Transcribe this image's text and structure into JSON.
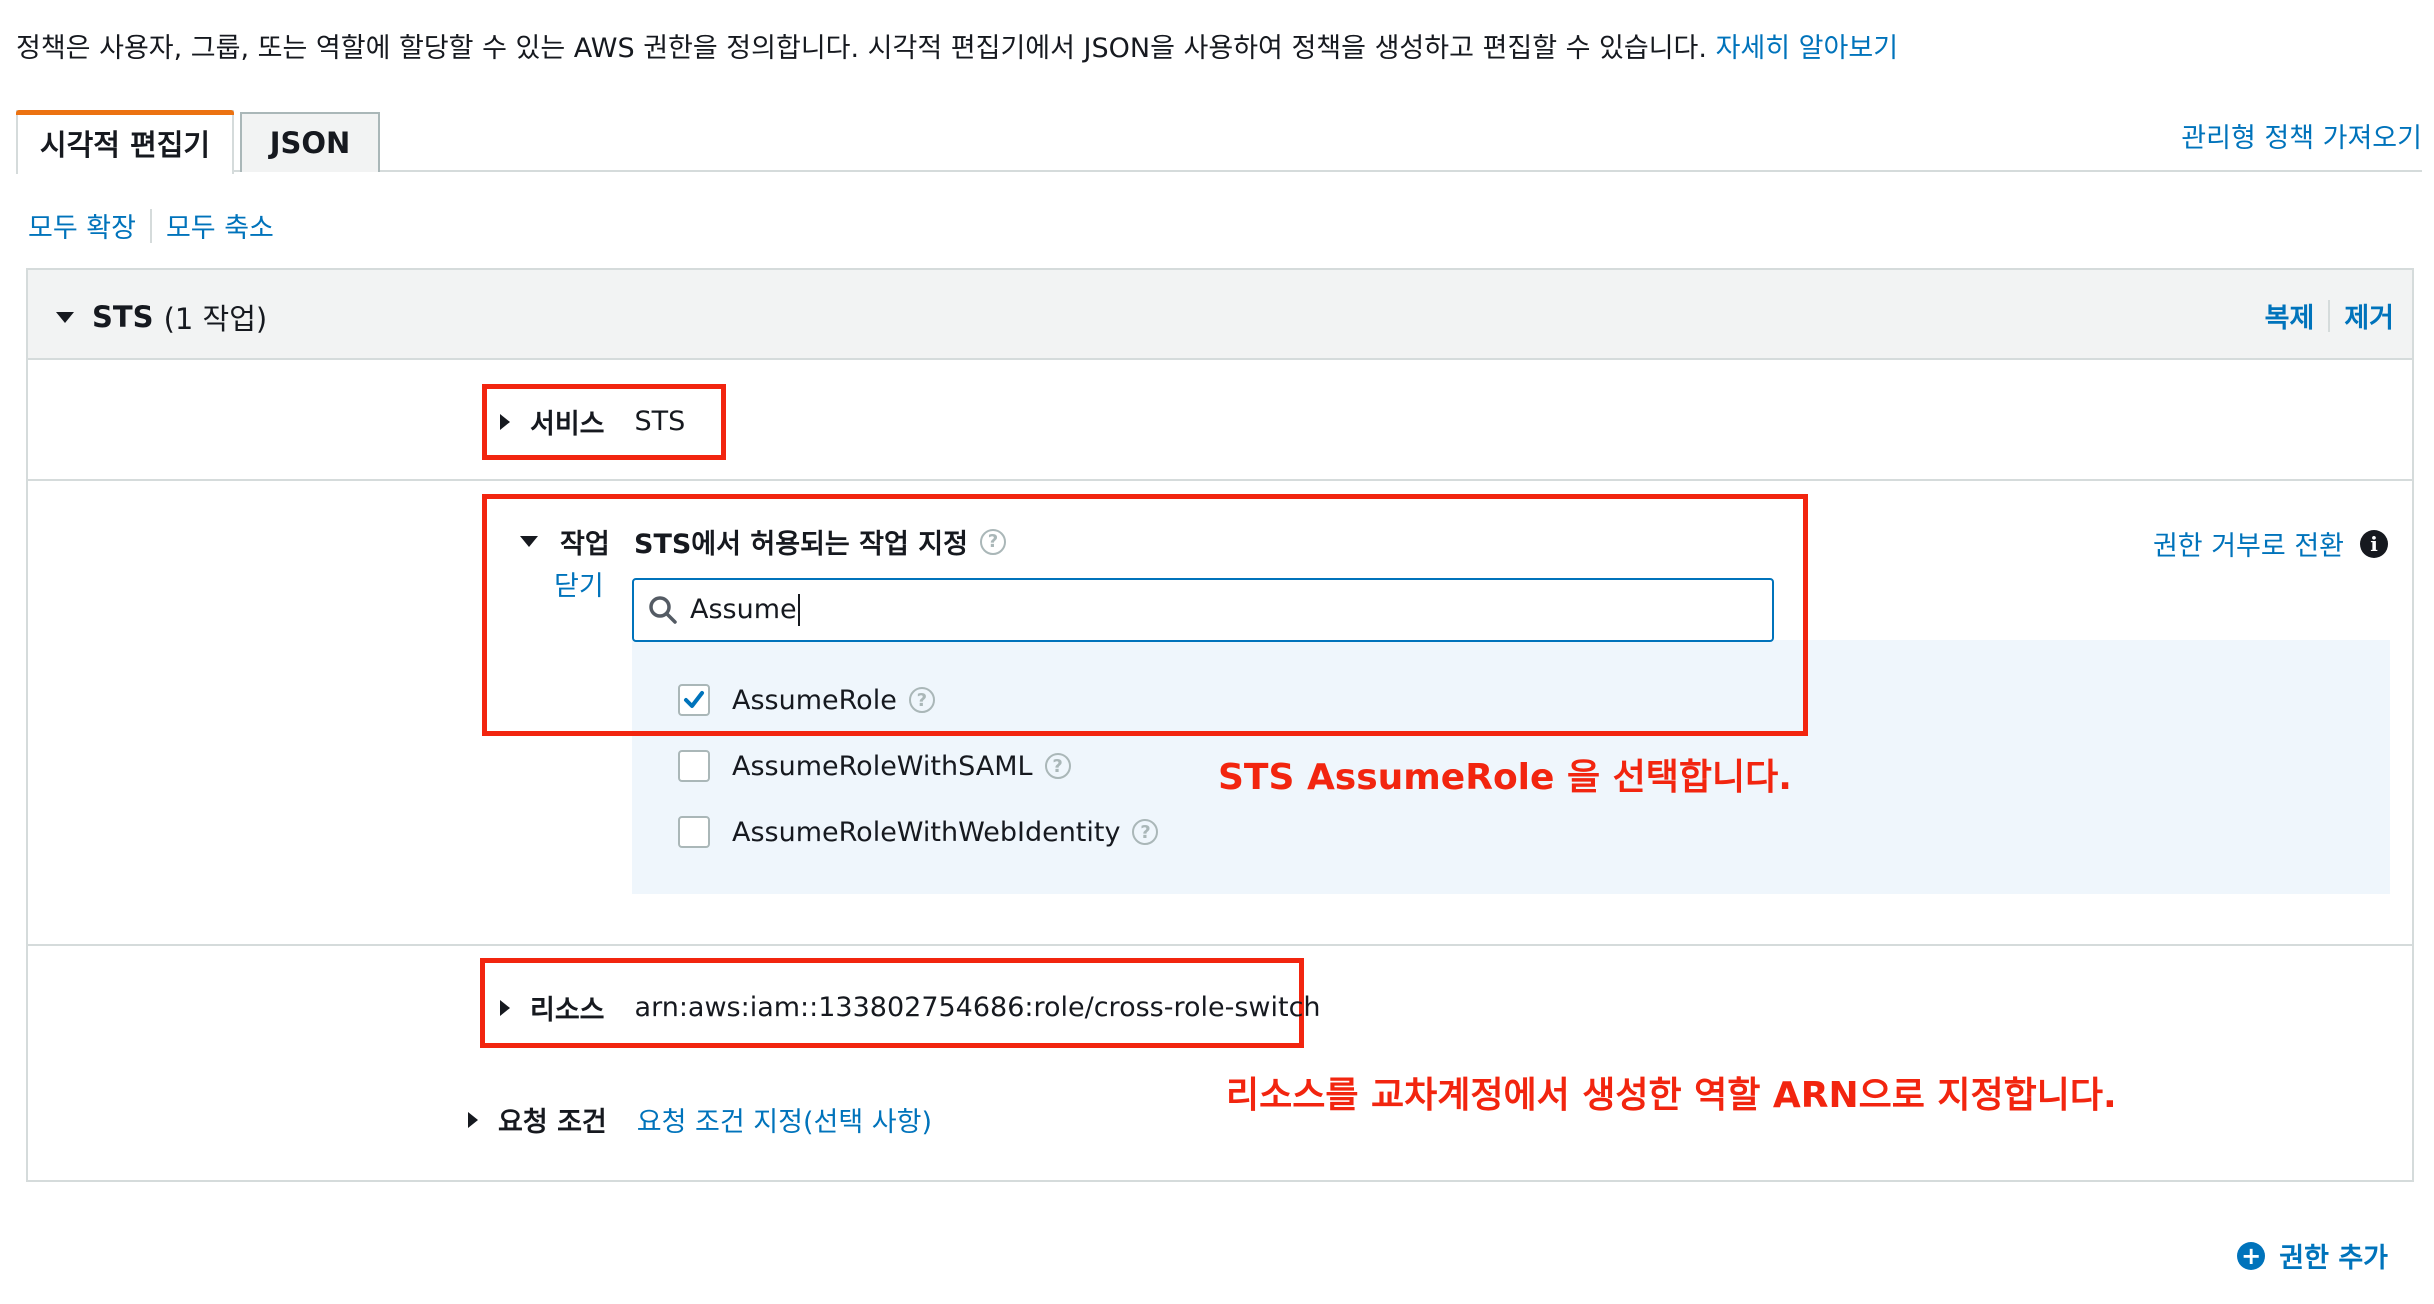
{
  "intro": {
    "text": "정책은 사용자, 그룹, 또는 역할에 할당할 수 있는 AWS 권한을 정의합니다. 시각적 편집기에서 JSON을 사용하여 정책을 생성하고 편집할 수 있습니다.",
    "learn_more": "자세히 알아보기"
  },
  "tabs": [
    {
      "label": "시각적 편집기",
      "active": true
    },
    {
      "label": "JSON",
      "active": false
    }
  ],
  "import_managed_policy": "관리형 정책 가져오기",
  "expand_all": "모두 확장",
  "collapse_all": "모두 축소",
  "statement": {
    "service_name": "STS",
    "count_text": "(1 작업)",
    "clone": "복제",
    "remove": "제거",
    "service": {
      "label": "서비스",
      "value": "STS"
    },
    "actions": {
      "label": "작업",
      "close": "닫기",
      "heading": "STS에서 허용되는 작업 지정",
      "switch_to_deny": "권한 거부로 전환",
      "search_value": "Assume",
      "options": [
        {
          "label": "AssumeRole",
          "checked": true
        },
        {
          "label": "AssumeRoleWithSAML",
          "checked": false
        },
        {
          "label": "AssumeRoleWithWebIdentity",
          "checked": false
        }
      ]
    },
    "resources": {
      "label": "리소스",
      "value": "arn:aws:iam::133802754686:role/cross-role-switch"
    },
    "conditions": {
      "label": "요청 조건",
      "value": "요청 조건 지정(선택 사항)"
    }
  },
  "annotations": {
    "assume_role": "STS AssumeRole 을 선택합니다.",
    "resource": "리소스를 교차계정에서 생성한 역할 ARN으로 지정합니다."
  },
  "add_permissions": "권한 추가",
  "colors": {
    "link": "#0073bb",
    "accent": "#ec7211",
    "annotation": "#f2250f",
    "check": "#0073bb"
  }
}
